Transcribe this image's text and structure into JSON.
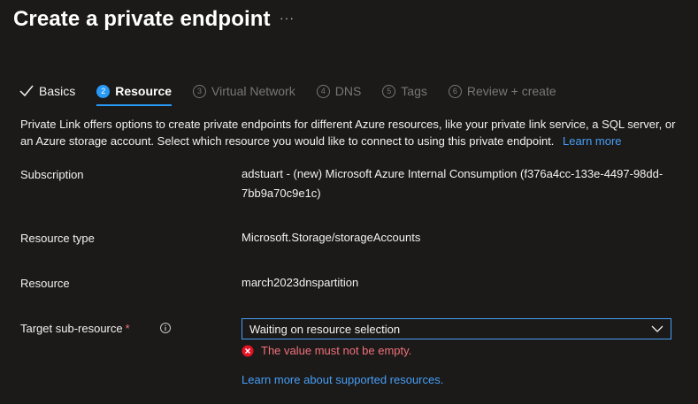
{
  "page": {
    "title": "Create a private endpoint",
    "more_label": "···"
  },
  "tabs": [
    {
      "label": "Basics",
      "state": "done",
      "number": ""
    },
    {
      "label": "Resource",
      "state": "active",
      "number": "2"
    },
    {
      "label": "Virtual Network",
      "state": "disabled",
      "number": "3"
    },
    {
      "label": "DNS",
      "state": "disabled",
      "number": "4"
    },
    {
      "label": "Tags",
      "state": "disabled",
      "number": "5"
    },
    {
      "label": "Review + create",
      "state": "disabled",
      "number": "6"
    }
  ],
  "description": {
    "text": "Private Link offers options to create private endpoints for different Azure resources, like your private link service, a SQL server, or an Azure storage account. Select which resource you would like to connect to using this private endpoint.",
    "link": "Learn more"
  },
  "fields": {
    "subscription": {
      "label": "Subscription",
      "value_line1": "adstuart - (new) Microsoft Azure Internal Consumption (f376a4cc-133e-4497-98dd-",
      "value_line2": "7bb9a70c9e1c)"
    },
    "resource_type": {
      "label": "Resource type",
      "value": "Microsoft.Storage/storageAccounts"
    },
    "resource": {
      "label": "Resource",
      "value": "march2023dnspartition"
    },
    "target_sub_resource": {
      "label": "Target sub-resource",
      "required_mark": "*",
      "selected_value": "Waiting on resource selection",
      "error": "The value must not be empty.",
      "help_link": "Learn more about supported resources."
    }
  },
  "colors": {
    "background": "#1b1a19",
    "accent": "#2899f5",
    "link": "#479ef5",
    "error": "#f1707b"
  },
  "icons": {
    "info": "info-icon",
    "error": "error-circle-icon",
    "dropdown": "chevron-down-icon",
    "done": "checkmark-icon"
  }
}
